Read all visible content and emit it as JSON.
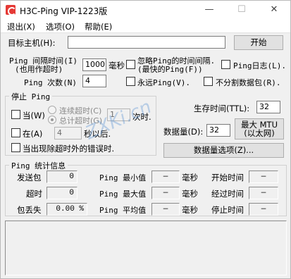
{
  "window": {
    "title": "H3C-Ping VIP-1223版"
  },
  "menu": [
    "退出(X)",
    "选项(O)",
    "帮助(E)"
  ],
  "host": {
    "label": "目标主机(H):",
    "value": "",
    "start_button": "开始"
  },
  "interval": {
    "label_line1": "Ping 间隔时间(I)",
    "label_line2": "(也用作超时)",
    "value": "1000",
    "unit": "毫秒"
  },
  "ignore_interval": {
    "label_line1": "忽略Ping的时间间隔.",
    "label_line2": "(最快的Ping(F))"
  },
  "ping_log": "Ping日志(L).",
  "count": {
    "label": "Ping 次数(N)",
    "value": "4"
  },
  "forever": "永远Ping(V).",
  "no_split": "不分割数据包(R).",
  "stop": {
    "title": "停止 Ping",
    "when": "当(W)",
    "consecutive_timeout": "连续超时(C)",
    "total_timeout": "总计超时(G)",
    "timeout_value": "1",
    "times": "次时.",
    "at": "在(A)",
    "seconds_value": "4",
    "seconds_after": "秒以后.",
    "on_error": "当出现除超时外的错误时."
  },
  "ttl": {
    "label": "生存时间(TTL):",
    "value": "32"
  },
  "data_size": {
    "label": "数据量(D):",
    "value": "32"
  },
  "max_mtu": {
    "line1": "最大 MTU",
    "line2": "(以太网)"
  },
  "data_options": "数据量选项(Z)...",
  "stats": {
    "title": "Ping 统计信息",
    "sent_label": "发送包",
    "sent": "0",
    "timeout_label": "超时",
    "timeout": "0",
    "loss_label": "包丢失",
    "loss": "0.00 %",
    "min_label": "Ping 最小值",
    "min": "—",
    "max_label": "Ping 最大值",
    "max": "—",
    "avg_label": "Ping 平均值",
    "avg": "—",
    "ms": "毫秒",
    "start_time_label": "开始时间",
    "start_time": "—",
    "elapsed_label": "经过时间",
    "elapsed": "—",
    "stop_time_label": "停止时间",
    "stop_time": "—"
  },
  "watermark": "ZXKi.cn"
}
